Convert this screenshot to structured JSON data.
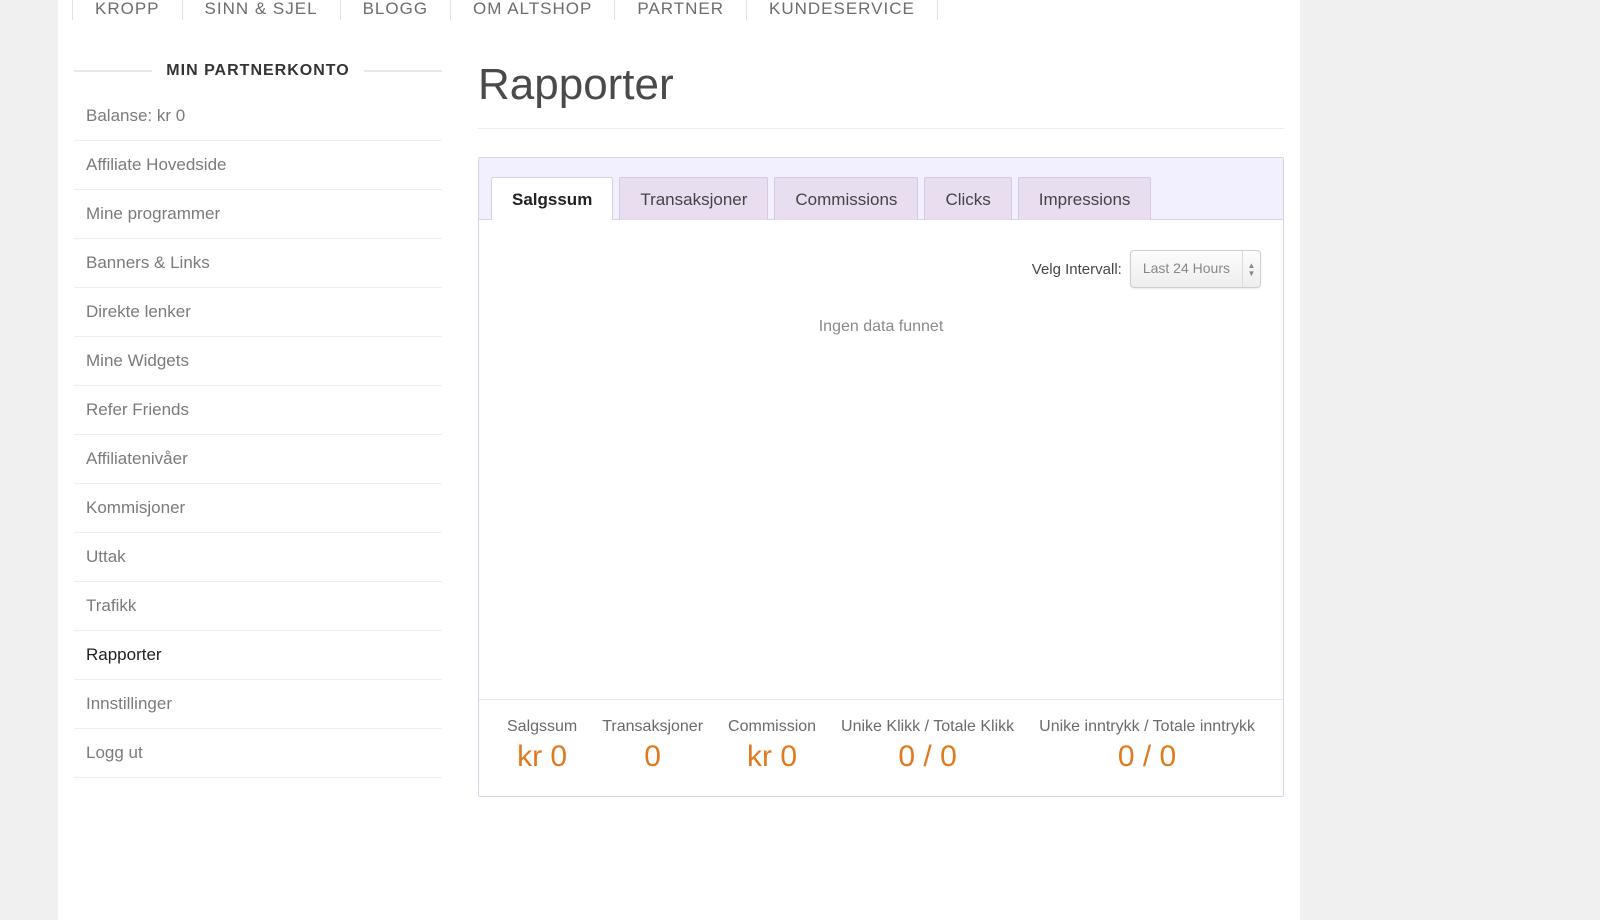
{
  "nav": {
    "items": [
      "KROPP",
      "SINN & SJEL",
      "BLOGG",
      "OM ALTSHOP",
      "PARTNER",
      "KUNDESERVICE"
    ]
  },
  "sidebar": {
    "heading": "MIN PARTNERKONTO",
    "items": [
      {
        "label": "Balanse: kr 0"
      },
      {
        "label": "Affiliate Hovedside"
      },
      {
        "label": "Mine programmer"
      },
      {
        "label": "Banners & Links"
      },
      {
        "label": "Direkte lenker"
      },
      {
        "label": "Mine Widgets"
      },
      {
        "label": "Refer Friends"
      },
      {
        "label": "Affiliatenivåer"
      },
      {
        "label": "Kommisjoner"
      },
      {
        "label": "Uttak"
      },
      {
        "label": "Trafikk"
      },
      {
        "label": "Rapporter",
        "active": true
      },
      {
        "label": "Innstillinger"
      },
      {
        "label": "Logg ut"
      }
    ]
  },
  "main": {
    "title": "Rapporter",
    "tabs": [
      {
        "label": "Salgssum",
        "active": true
      },
      {
        "label": "Transaksjoner"
      },
      {
        "label": "Commissions"
      },
      {
        "label": "Clicks"
      },
      {
        "label": "Impressions"
      }
    ],
    "interval_label": "Velg Intervall:",
    "interval_selected": "Last 24 Hours",
    "no_data_message": "Ingen data funnet",
    "summary": [
      {
        "label": "Salgssum",
        "value": "kr 0"
      },
      {
        "label": "Transaksjoner",
        "value": "0"
      },
      {
        "label": "Commission",
        "value": "kr 0"
      },
      {
        "label": "Unike Klikk / Totale Klikk",
        "value": "0 / 0"
      },
      {
        "label": "Unike inntrykk / Totale inntrykk",
        "value": "0 / 0"
      }
    ]
  },
  "chart_data": {
    "type": "table",
    "title": "Ingen data funnet",
    "columns": [],
    "rows": []
  }
}
